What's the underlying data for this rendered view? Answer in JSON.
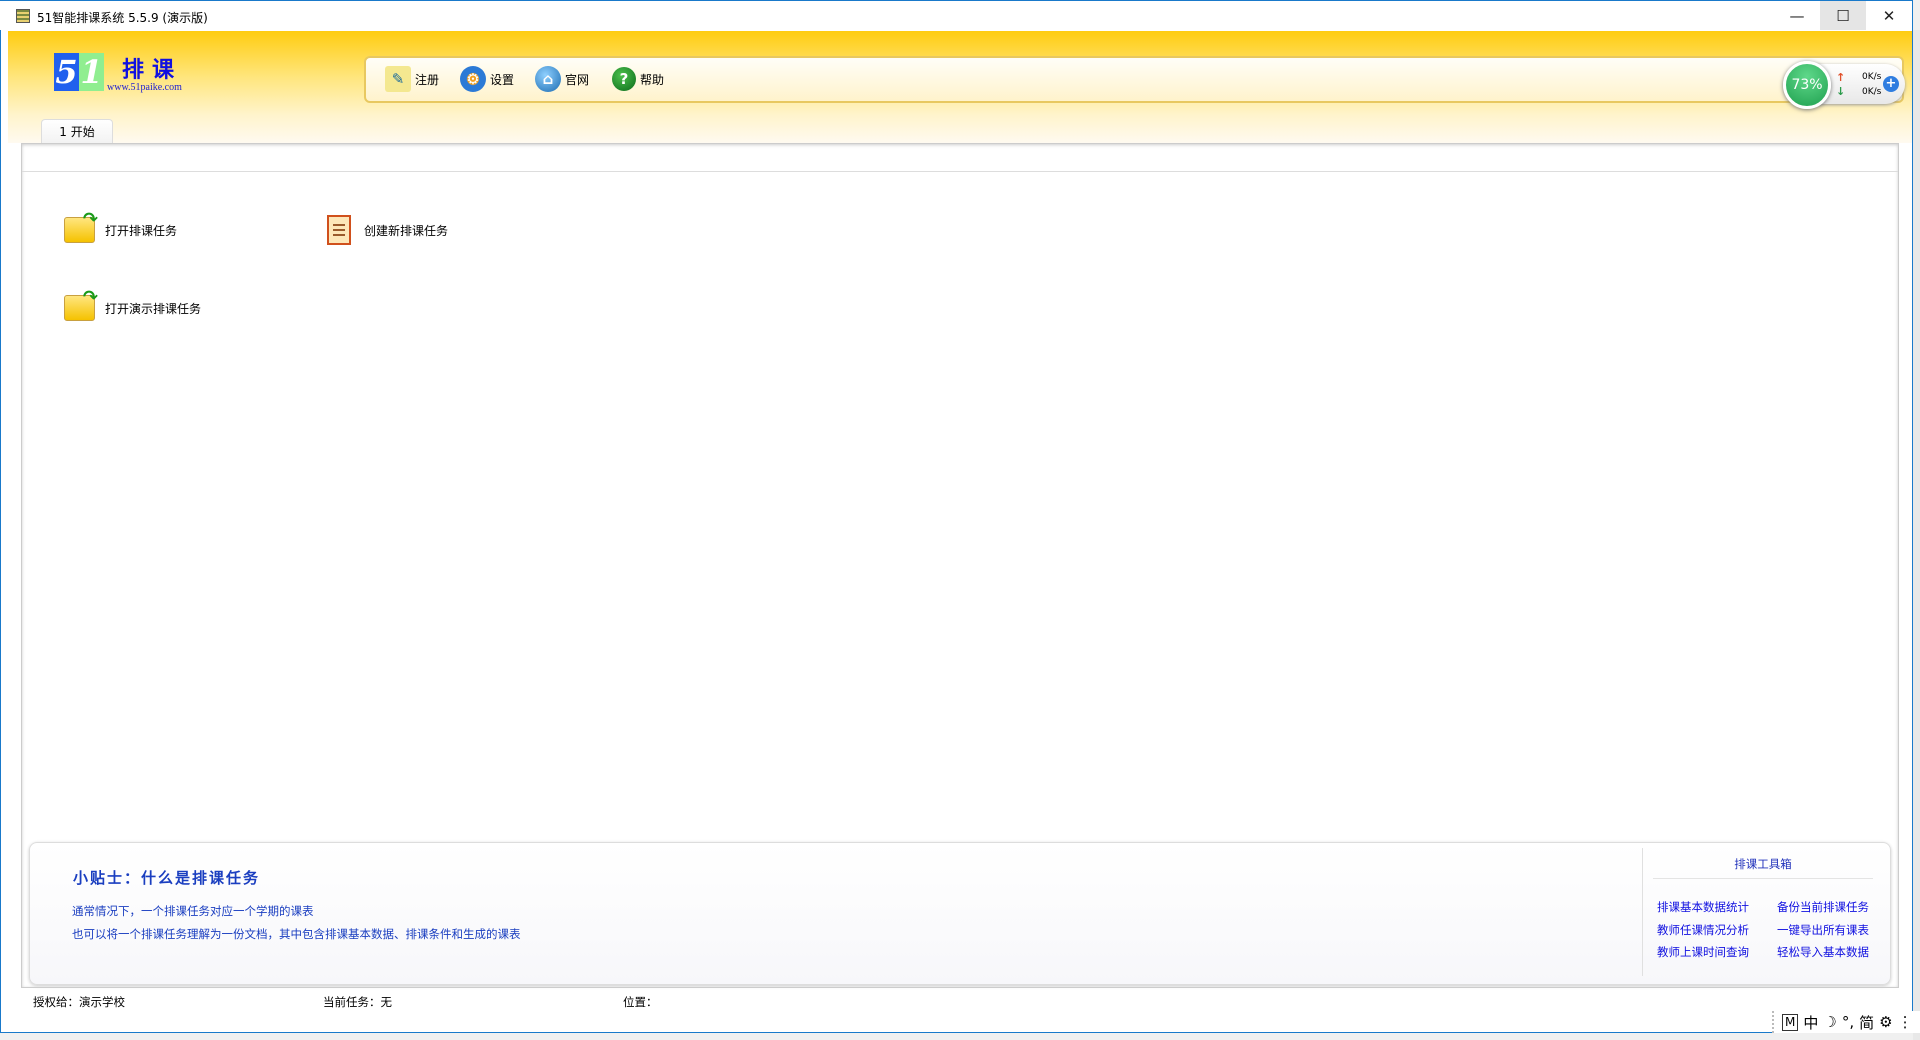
{
  "window": {
    "title": "51智能排课系统 5.5.9 (演示版)",
    "min": "—",
    "max": "☐",
    "close": "✕"
  },
  "logo": {
    "num1": "5",
    "num2": "1",
    "text": "排课",
    "url": "www.51paike.com"
  },
  "toolbar": {
    "items": [
      {
        "label": "注册",
        "icon": "register-icon"
      },
      {
        "label": "设置",
        "icon": "gear-icon"
      },
      {
        "label": "官网",
        "icon": "globe-home-icon"
      },
      {
        "label": "帮助",
        "icon": "help-icon"
      }
    ]
  },
  "monitor": {
    "percent": "73%",
    "up": "0K/s",
    "down": "0K/s",
    "up_arrow": "↑",
    "down_arrow": "↓",
    "plus": "+"
  },
  "tabs": [
    {
      "label": "1 开始"
    }
  ],
  "actions": {
    "open": "打开排课任务",
    "create": "创建新排课任务",
    "open_demo": "打开演示排课任务"
  },
  "tip": {
    "title": "小贴士：什么是排课任务",
    "lines": [
      "通常情况下，一个排课任务对应一个学期的课表",
      "也可以将一个排课任务理解为一份文档，其中包含排课基本数据、排课条件和生成的课表"
    ]
  },
  "toolbox": {
    "title": "排课工具箱",
    "links": [
      "排课基本数据统计",
      "备份当前排课任务",
      "教师任课情况分析",
      "一键导出所有课表",
      "教师上课时间查询",
      "轻松导入基本数据"
    ]
  },
  "status": {
    "license": "授权给：演示学校",
    "task": "当前任务：无",
    "position": "位置："
  },
  "ime": {
    "m": "M",
    "lang": "中",
    "moon": "☽",
    "punct": "°,",
    "simp": "简",
    "gear": "⚙",
    "more": "⋮"
  }
}
